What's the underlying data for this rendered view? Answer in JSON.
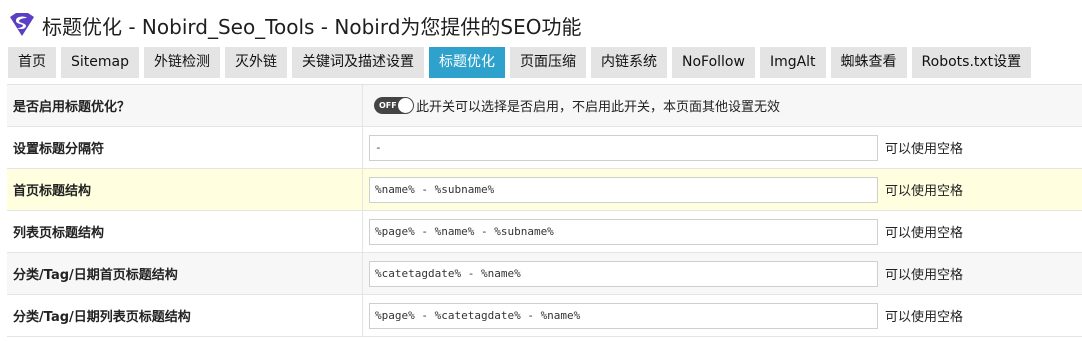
{
  "page": {
    "title": "标题优化 - Nobird_Seo_Tools - Nobird为您提供的SEO功能",
    "logo_icon": "superman-shield-icon",
    "accent_color": "#2ea2cc",
    "logo_color": "#5b3fc4"
  },
  "tabs": [
    {
      "label": "首页",
      "active": false
    },
    {
      "label": "Sitemap",
      "active": false
    },
    {
      "label": "外链检测",
      "active": false
    },
    {
      "label": "灭外链",
      "active": false
    },
    {
      "label": "关键词及描述设置",
      "active": false
    },
    {
      "label": "标题优化",
      "active": true
    },
    {
      "label": "页面压缩",
      "active": false
    },
    {
      "label": "内链系统",
      "active": false
    },
    {
      "label": "NoFollow",
      "active": false
    },
    {
      "label": "ImgAlt",
      "active": false
    },
    {
      "label": "蜘蛛查看",
      "active": false
    },
    {
      "label": "Robots.txt设置",
      "active": false
    }
  ],
  "settings": {
    "enable": {
      "label": "是否启用标题优化？",
      "toggle_text": "OFF",
      "toggle_state": "off",
      "description": "此开关可以选择是否启用，不启用此开关，本页面其他设置无效"
    },
    "separator": {
      "label": "设置标题分隔符",
      "value": "-",
      "note": "可以使用空格"
    },
    "home": {
      "label": "首页标题结构",
      "value": "%name% - %subname%",
      "note": "可以使用空格"
    },
    "list": {
      "label": "列表页标题结构",
      "value": "%page% - %name% - %subname%",
      "note": "可以使用空格"
    },
    "category_home": {
      "label": "分类/Tag/日期首页标题结构",
      "value": "%catetagdate% - %name%",
      "note": "可以使用空格"
    },
    "category_list": {
      "label": "分类/Tag/日期列表页标题结构",
      "value": "%page% - %catetagdate% - %name%",
      "note": "可以使用空格"
    }
  }
}
